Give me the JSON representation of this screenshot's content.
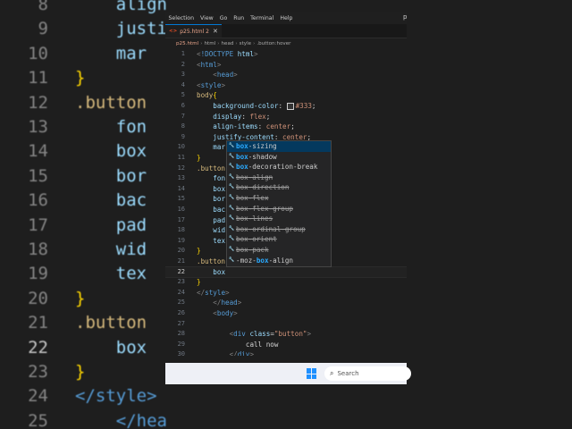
{
  "background_zoom": {
    "lines": [
      {
        "num": "8",
        "code": "    align"
      },
      {
        "num": "9",
        "code": "    justi"
      },
      {
        "num": "10",
        "code": "    mar"
      },
      {
        "num": "11",
        "code": "}"
      },
      {
        "num": "12",
        "code": ".button"
      },
      {
        "num": "13",
        "code": "    fon"
      },
      {
        "num": "14",
        "code": "    box"
      },
      {
        "num": "15",
        "code": "    bor"
      },
      {
        "num": "16",
        "code": "    bac"
      },
      {
        "num": "17",
        "code": "    pad"
      },
      {
        "num": "18",
        "code": "    wid"
      },
      {
        "num": "19",
        "code": "    tex"
      },
      {
        "num": "20",
        "code": "}"
      },
      {
        "num": "21",
        "code": ".button"
      },
      {
        "num": "22",
        "code": "    box"
      },
      {
        "num": "23",
        "code": "}"
      },
      {
        "num": "24",
        "code": "</style>"
      },
      {
        "num": "25",
        "code": "    </hea"
      }
    ]
  },
  "menubar": [
    "Selection",
    "View",
    "Go",
    "Run",
    "Terminal",
    "Help"
  ],
  "tab": {
    "label": "p25.html 2",
    "icon": "html-file-icon"
  },
  "breadcrumb": [
    "p25.html",
    "html",
    "head",
    "style",
    ".button:hover"
  ],
  "editor": {
    "lines": [
      {
        "n": "1",
        "html": "<span class='br'>&lt;</span><span class='kw'>!DOCTYPE</span> <span class='attr'>html</span><span class='br'>&gt;</span>"
      },
      {
        "n": "2",
        "html": "<span class='br'>&lt;</span><span class='tag'>html</span><span class='br'>&gt;</span>"
      },
      {
        "n": "3",
        "html": "    <span class='br'>&lt;</span><span class='tag'>head</span><span class='br'>&gt;</span>"
      },
      {
        "n": "4",
        "html": "<span class='br'>&lt;</span><span class='tag'>style</span><span class='br'>&gt;</span>"
      },
      {
        "n": "5",
        "html": "<span class='sel'>body</span><span class='yel'>{</span>"
      },
      {
        "n": "6",
        "html": "    <span class='prop'>background-color</span><span class='txt'>: </span><span class='swatch'></span><span class='val'>#333</span><span class='txt'>;</span>"
      },
      {
        "n": "7",
        "html": "    <span class='prop'>display</span><span class='txt'>: </span><span class='val'>flex</span><span class='txt'>;</span>"
      },
      {
        "n": "8",
        "html": "    <span class='prop'>align-items</span><span class='txt'>: </span><span class='val'>center</span><span class='txt'>;</span>"
      },
      {
        "n": "9",
        "html": "    <span class='prop'>justify-content</span><span class='txt'>: </span><span class='val'>center</span><span class='txt'>;</span>"
      },
      {
        "n": "10",
        "html": "    <span class='prop'>mar</span>"
      },
      {
        "n": "11",
        "html": "<span class='yel'>}</span>"
      },
      {
        "n": "12",
        "html": "<span class='sel'>.button</span>"
      },
      {
        "n": "13",
        "html": "    <span class='prop'>fon</span>"
      },
      {
        "n": "14",
        "html": "    <span class='prop'>box</span>"
      },
      {
        "n": "15",
        "html": "    <span class='prop'>bor</span>"
      },
      {
        "n": "16",
        "html": "    <span class='prop'>bac</span>"
      },
      {
        "n": "17",
        "html": "    <span class='prop'>pad</span>"
      },
      {
        "n": "18",
        "html": "    <span class='prop'>wid</span>"
      },
      {
        "n": "19",
        "html": "    <span class='prop'>tex</span>"
      },
      {
        "n": "20",
        "html": "<span class='yel'>}</span>"
      },
      {
        "n": "21",
        "html": "<span class='sel'>.button</span>"
      },
      {
        "n": "22",
        "html": "    <span class='prop'>box</span>"
      },
      {
        "n": "23",
        "html": "<span class='yel'>}</span>"
      },
      {
        "n": "24",
        "html": "<span class='br'>&lt;/</span><span class='tag'>style</span><span class='br'>&gt;</span>"
      },
      {
        "n": "25",
        "html": "    <span class='br'>&lt;/</span><span class='tag'>head</span><span class='br'>&gt;</span>"
      },
      {
        "n": "26",
        "html": "    <span class='br'>&lt;</span><span class='tag'>body</span><span class='br'>&gt;</span>"
      },
      {
        "n": "27",
        "html": ""
      },
      {
        "n": "28",
        "html": "        <span class='br'>&lt;</span><span class='tag'>div</span> <span class='attr'>class</span><span class='txt'>=</span><span class='str'>\"button\"</span><span class='br'>&gt;</span>"
      },
      {
        "n": "29",
        "html": "            <span class='txt'>call now</span>"
      },
      {
        "n": "30",
        "html": "        <span class='br'>&lt;/</span><span class='tag'>div</span><span class='br'>&gt;</span>"
      }
    ],
    "active_line": "22"
  },
  "suggestions": [
    {
      "pre": "",
      "hl": "box",
      "post": "-sizing",
      "deprecated": false
    },
    {
      "pre": "",
      "hl": "box",
      "post": "-shadow",
      "deprecated": false
    },
    {
      "pre": "",
      "hl": "box",
      "post": "-decoration-break",
      "deprecated": false
    },
    {
      "pre": "",
      "hl": "box",
      "post": "-align",
      "deprecated": true
    },
    {
      "pre": "",
      "hl": "box",
      "post": "-direction",
      "deprecated": true
    },
    {
      "pre": "",
      "hl": "box",
      "post": "-flex",
      "deprecated": true
    },
    {
      "pre": "",
      "hl": "box",
      "post": "-flex-group",
      "deprecated": true
    },
    {
      "pre": "",
      "hl": "box",
      "post": "-lines",
      "deprecated": true
    },
    {
      "pre": "",
      "hl": "box",
      "post": "-ordinal-group",
      "deprecated": true
    },
    {
      "pre": "",
      "hl": "box",
      "post": "-orient",
      "deprecated": true
    },
    {
      "pre": "",
      "hl": "box",
      "post": "-pack",
      "deprecated": true
    },
    {
      "pre": "-moz-",
      "hl": "box",
      "post": "-align",
      "deprecated": false
    }
  ],
  "taskbar": {
    "search_placeholder": "Search",
    "windows_icon": "windows-start-icon"
  },
  "right_label": "p",
  "colors": {
    "accent": "#0078d4",
    "editor_bg": "#1e1e1e",
    "suggest_selected": "#04395e",
    "taskbar_bg": "#eef0f6"
  }
}
